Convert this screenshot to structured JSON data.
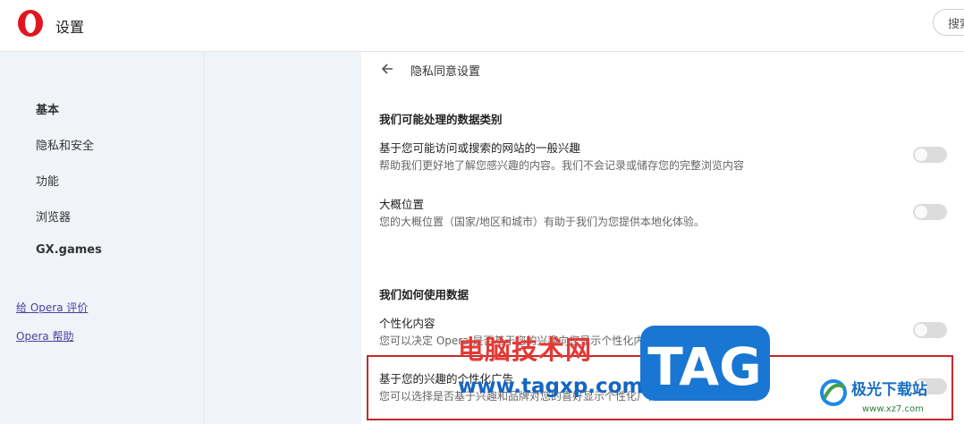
{
  "app": {
    "title": "设置",
    "search_label": "搜索"
  },
  "sidebar": {
    "items": [
      {
        "label": "基本"
      },
      {
        "label": "隐私和安全"
      },
      {
        "label": "功能"
      },
      {
        "label": "浏览器"
      },
      {
        "label": "GX.games"
      }
    ],
    "links": [
      {
        "label": "给 Opera 评价"
      },
      {
        "label": "Opera 帮助"
      }
    ]
  },
  "main": {
    "page_title": "隐私同意设置",
    "section1": {
      "heading": "我们可能处理的数据类别",
      "rows": [
        {
          "title": "基于您可能访问或搜索的网站的一般兴趣",
          "desc": "帮助我们更好地了解您感兴趣的内容。我们不会记录或储存您的完整浏览内容",
          "enabled": false
        },
        {
          "title": "大概位置",
          "desc": "您的大概位置（国家/地区和城市）有助于我们为您提供本地化体验。",
          "enabled": false
        }
      ]
    },
    "section2": {
      "heading": "我们如何使用数据",
      "rows": [
        {
          "title": "个性化内容",
          "desc": "您可以决定 Opera 是否基于您的兴趣向您显示个性化内容",
          "enabled": false
        },
        {
          "title": "基于您的兴趣的个性化广告",
          "desc": "您可以选择是否基于兴趣和品牌对您的喜好显示个性化广告。",
          "enabled": false
        }
      ]
    }
  },
  "watermark": {
    "text": "电脑技术网",
    "url": "www.tagxp.com",
    "tag": "TAG",
    "brand": "极光下载站",
    "brand_url": "www.xz7.com"
  },
  "colors": {
    "accent": "#d32f2f",
    "highlight": "#c62828",
    "watermark_blue": "#1565c0"
  }
}
